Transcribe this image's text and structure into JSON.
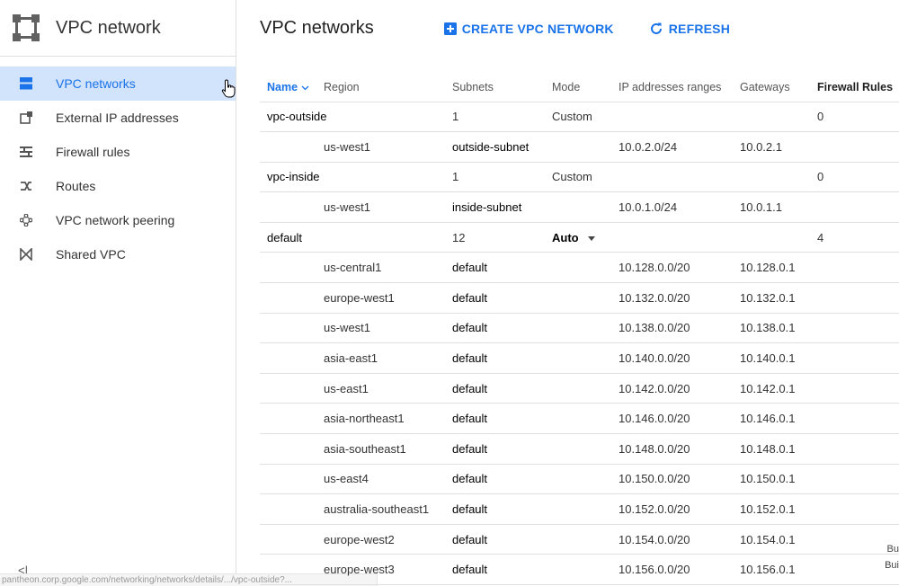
{
  "sidebar": {
    "product_title": "VPC network",
    "items": [
      {
        "label": "VPC networks",
        "icon": "vpc-networks-icon"
      },
      {
        "label": "External IP addresses",
        "icon": "external-ip-icon"
      },
      {
        "label": "Firewall rules",
        "icon": "firewall-icon"
      },
      {
        "label": "Routes",
        "icon": "routes-icon"
      },
      {
        "label": "VPC network peering",
        "icon": "peering-icon"
      },
      {
        "label": "Shared VPC",
        "icon": "shared-vpc-icon"
      }
    ],
    "collapse_label": "<|",
    "status_url": "pantheon.corp.google.com/networking/networks/details/.../vpc-outside?..."
  },
  "header": {
    "title": "VPC networks",
    "create_label": "CREATE VPC NETWORK",
    "refresh_label": "REFRESH"
  },
  "table": {
    "columns": [
      "Name",
      "Region",
      "Subnets",
      "Mode",
      "IP addresses ranges",
      "Gateways",
      "Firewall Rules"
    ],
    "rows": [
      {
        "type": "network",
        "name": "vpc-outside",
        "region": "",
        "subnets": "1",
        "mode": "Custom",
        "ip_range": "",
        "gateway": "",
        "firewall": "0"
      },
      {
        "type": "subnet",
        "name": "",
        "region": "us-west1",
        "subnets": "outside-subnet",
        "mode": "",
        "ip_range": "10.0.2.0/24",
        "gateway": "10.0.2.1",
        "firewall": ""
      },
      {
        "type": "network",
        "name": "vpc-inside",
        "region": "",
        "subnets": "1",
        "mode": "Custom",
        "ip_range": "",
        "gateway": "",
        "firewall": "0"
      },
      {
        "type": "subnet",
        "name": "",
        "region": "us-west1",
        "subnets": "inside-subnet",
        "mode": "",
        "ip_range": "10.0.1.0/24",
        "gateway": "10.0.1.1",
        "firewall": ""
      },
      {
        "type": "network",
        "name": "default",
        "region": "",
        "subnets": "12",
        "mode": "Auto",
        "ip_range": "",
        "gateway": "",
        "firewall": "4"
      },
      {
        "type": "subnet",
        "name": "",
        "region": "us-central1",
        "subnets": "default",
        "mode": "",
        "ip_range": "10.128.0.0/20",
        "gateway": "10.128.0.1",
        "firewall": ""
      },
      {
        "type": "subnet",
        "name": "",
        "region": "europe-west1",
        "subnets": "default",
        "mode": "",
        "ip_range": "10.132.0.0/20",
        "gateway": "10.132.0.1",
        "firewall": ""
      },
      {
        "type": "subnet",
        "name": "",
        "region": "us-west1",
        "subnets": "default",
        "mode": "",
        "ip_range": "10.138.0.0/20",
        "gateway": "10.138.0.1",
        "firewall": ""
      },
      {
        "type": "subnet",
        "name": "",
        "region": "asia-east1",
        "subnets": "default",
        "mode": "",
        "ip_range": "10.140.0.0/20",
        "gateway": "10.140.0.1",
        "firewall": ""
      },
      {
        "type": "subnet",
        "name": "",
        "region": "us-east1",
        "subnets": "default",
        "mode": "",
        "ip_range": "10.142.0.0/20",
        "gateway": "10.142.0.1",
        "firewall": ""
      },
      {
        "type": "subnet",
        "name": "",
        "region": "asia-northeast1",
        "subnets": "default",
        "mode": "",
        "ip_range": "10.146.0.0/20",
        "gateway": "10.146.0.1",
        "firewall": ""
      },
      {
        "type": "subnet",
        "name": "",
        "region": "asia-southeast1",
        "subnets": "default",
        "mode": "",
        "ip_range": "10.148.0.0/20",
        "gateway": "10.148.0.1",
        "firewall": ""
      },
      {
        "type": "subnet",
        "name": "",
        "region": "us-east4",
        "subnets": "default",
        "mode": "",
        "ip_range": "10.150.0.0/20",
        "gateway": "10.150.0.1",
        "firewall": ""
      },
      {
        "type": "subnet",
        "name": "",
        "region": "australia-southeast1",
        "subnets": "default",
        "mode": "",
        "ip_range": "10.152.0.0/20",
        "gateway": "10.152.0.1",
        "firewall": ""
      },
      {
        "type": "subnet",
        "name": "",
        "region": "europe-west2",
        "subnets": "default",
        "mode": "",
        "ip_range": "10.154.0.0/20",
        "gateway": "10.154.0.1",
        "firewall": ""
      },
      {
        "type": "subnet",
        "name": "",
        "region": "europe-west3",
        "subnets": "default",
        "mode": "",
        "ip_range": "10.156.0.0/20",
        "gateway": "10.156.0.1",
        "firewall": ""
      }
    ]
  },
  "corner": {
    "line1": "Bu",
    "line2": "Bui"
  },
  "colors": {
    "accent": "#1a73e8",
    "active_bg": "#d2e3fc",
    "divider": "#e0e0e0"
  }
}
